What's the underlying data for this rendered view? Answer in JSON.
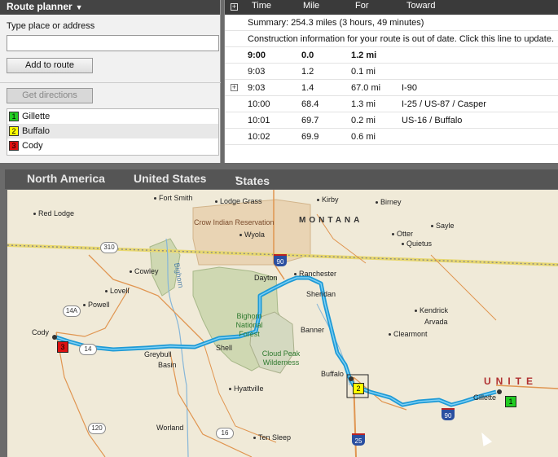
{
  "planner": {
    "title": "Route planner",
    "place_label": "Type place or address",
    "address_value": "",
    "add_button": "Add to route",
    "directions_button": "Get directions",
    "stops": [
      {
        "num": "1",
        "name": "Gillette",
        "color": "#22cc22"
      },
      {
        "num": "2",
        "name": "Buffalo",
        "color": "#ffff00"
      },
      {
        "num": "3",
        "name": "Cody",
        "color": "#dd1111"
      }
    ]
  },
  "directions": {
    "headers": {
      "time": "Time",
      "mile": "Mile",
      "for": "For",
      "toward": "Toward"
    },
    "summary": "Summary:  254.3 miles (3 hours, 49 minutes)",
    "construction": "Construction information for your route is out of date.  Click this line to update.",
    "rows": [
      {
        "time": "9:00",
        "mile": "0.0",
        "for": "1.2 mi",
        "toward": ""
      },
      {
        "time": "9:03",
        "mile": "1.2",
        "for": "0.1 mi",
        "toward": ""
      },
      {
        "time": "9:03",
        "mile": "1.4",
        "for": "67.0 mi",
        "toward": "I-90"
      },
      {
        "time": "10:00",
        "mile": "68.4",
        "for": "1.3 mi",
        "toward": "I-25 / US-87 / Casper"
      },
      {
        "time": "10:01",
        "mile": "69.7",
        "for": "0.2 mi",
        "toward": "US-16 / Buffalo"
      },
      {
        "time": "10:02",
        "mile": "69.9",
        "for": "0.6 mi",
        "toward": ""
      }
    ]
  },
  "mapnav": {
    "region": "North America",
    "country": "United States",
    "states": "States"
  },
  "map": {
    "state_label": "MONTANA",
    "country_label": "UNITE",
    "reservation": "Crow Indian Reservation",
    "forest": "Bighorn National Forest",
    "wilderness": "Cloud Peak Wilderness",
    "river": "Bighorn",
    "places": {
      "fort_smith": "Fort Smith",
      "lodge_grass": "Lodge Grass",
      "kirby": "Kirby",
      "birney": "Birney",
      "red_lodge": "Red Lodge",
      "sayle": "Sayle",
      "wyola": "Wyola",
      "otter": "Otter",
      "quietus": "Quietus",
      "cowley": "Cowley",
      "lovell": "Lovell",
      "dayton": "Dayton",
      "ranchester": "Ranchester",
      "sheridan": "Sheridan",
      "powell": "Powell",
      "kendrick": "Kendrick",
      "arvada": "Arvada",
      "banner": "Banner",
      "clearmont": "Clearmont",
      "cody": "Cody",
      "shell": "Shell",
      "greybull": "Greybull",
      "basin": "Basin",
      "buffalo": "Buffalo",
      "gillette": "Gillette",
      "hyattville": "Hyattville",
      "worland": "Worland",
      "ten_sleep": "Ten Sleep"
    },
    "shields": {
      "us310": "310",
      "wy14a": "14A",
      "us14": "14",
      "wy120": "120",
      "us16": "16",
      "i90a": "90",
      "i90b": "90",
      "i25": "25"
    },
    "markers": [
      {
        "num": "1",
        "color": "#22cc22"
      },
      {
        "num": "2",
        "color": "#ffff00"
      },
      {
        "num": "3",
        "color": "#dd1111"
      }
    ],
    "route_color": "#1e9ad6"
  }
}
